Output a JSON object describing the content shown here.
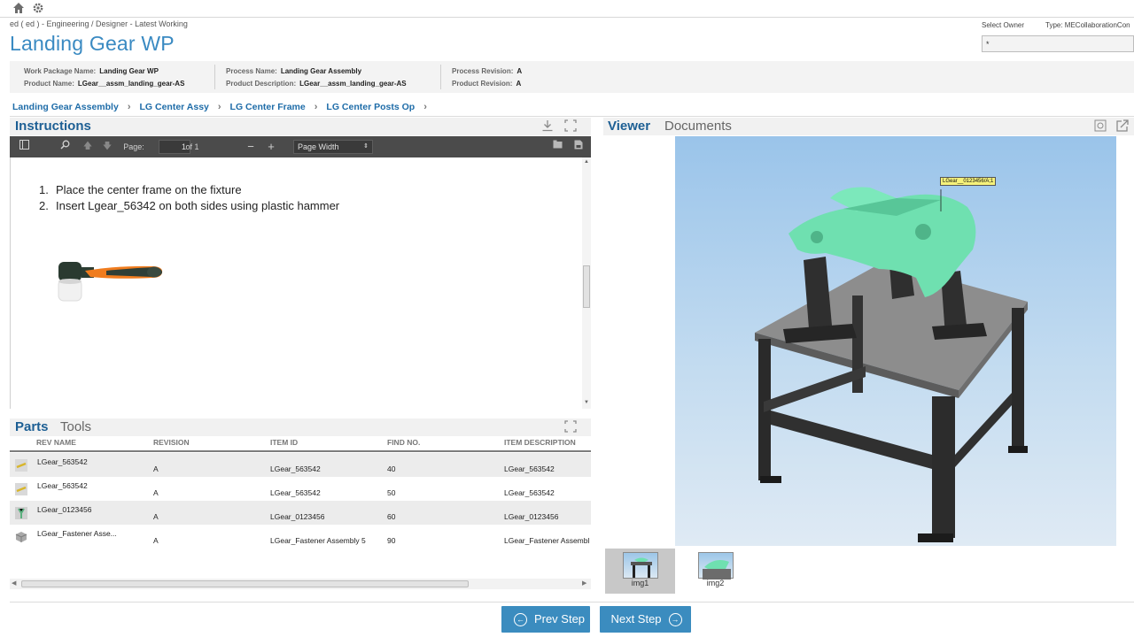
{
  "header": {
    "breadcrumb_path": "ed ( ed ) - Engineering / Designer - Latest Working",
    "title": "Landing Gear WP",
    "select_owner_label": "Select Owner",
    "type_label": "Type: MECollaborationCon",
    "owner_value": "*"
  },
  "info": {
    "work_package_name_label": "Work Package Name:",
    "work_package_name": "Landing Gear WP",
    "product_name_label": "Product Name:",
    "product_name": "LGear__assm_landing_gear-AS",
    "process_name_label": "Process Name:",
    "process_name": "Landing Gear Assembly",
    "product_description_label": "Product Description:",
    "product_description": "LGear__assm_landing_gear-AS",
    "process_revision_label": "Process Revision:",
    "process_revision": "A",
    "product_revision_label": "Product Revision:",
    "product_revision": "A"
  },
  "steps": [
    "Landing Gear Assembly",
    "LG Center Assy",
    "LG Center Frame",
    "LG Center Posts Op"
  ],
  "instructions": {
    "title": "Instructions",
    "page_label": "Page:",
    "page_value": "1",
    "page_of": "of 1",
    "zoom": "Page Width",
    "items": [
      "Place the center frame on the fixture",
      "Insert Lgear_56342 on both sides using plastic hammer"
    ],
    "item_numbers": [
      "1.",
      "2."
    ]
  },
  "parts": {
    "tab_parts": "Parts",
    "tab_tools": "Tools",
    "columns": [
      "REV NAME",
      "REVISION",
      "ITEM ID",
      "FIND NO.",
      "ITEM DESCRIPTION"
    ],
    "rows": [
      {
        "rev_name": "LGear_563542",
        "revision": "A",
        "item_id": "LGear_563542",
        "find_no": "40",
        "description": "LGear_563542",
        "icon": "pin-part-icon"
      },
      {
        "rev_name": "LGear_563542",
        "revision": "A",
        "item_id": "LGear_563542",
        "find_no": "50",
        "description": "LGear_563542",
        "icon": "pin-part-icon"
      },
      {
        "rev_name": "LGear_0123456",
        "revision": "A",
        "item_id": "LGear_0123456",
        "find_no": "60",
        "description": "LGear_0123456",
        "icon": "frame-part-icon"
      },
      {
        "rev_name": "LGear_Fastener Asse...",
        "revision": "A",
        "item_id": "LGear_Fastener Assembly 5",
        "find_no": "90",
        "description": "LGear_Fastener Assembl",
        "icon": "assembly-icon"
      }
    ]
  },
  "viewer": {
    "tab_viewer": "Viewer",
    "tab_documents": "Documents",
    "callout": "LGear__0123456/A;1",
    "thumbnails": [
      "img1",
      "img2"
    ]
  },
  "footer": {
    "prev": "Prev Step",
    "next": "Next Step"
  },
  "colors": {
    "accent_blue": "#3b8cbf",
    "title_blue": "#3a8ac2",
    "tab_blue": "#1d5f94",
    "part_green": "#6fe0b0"
  }
}
